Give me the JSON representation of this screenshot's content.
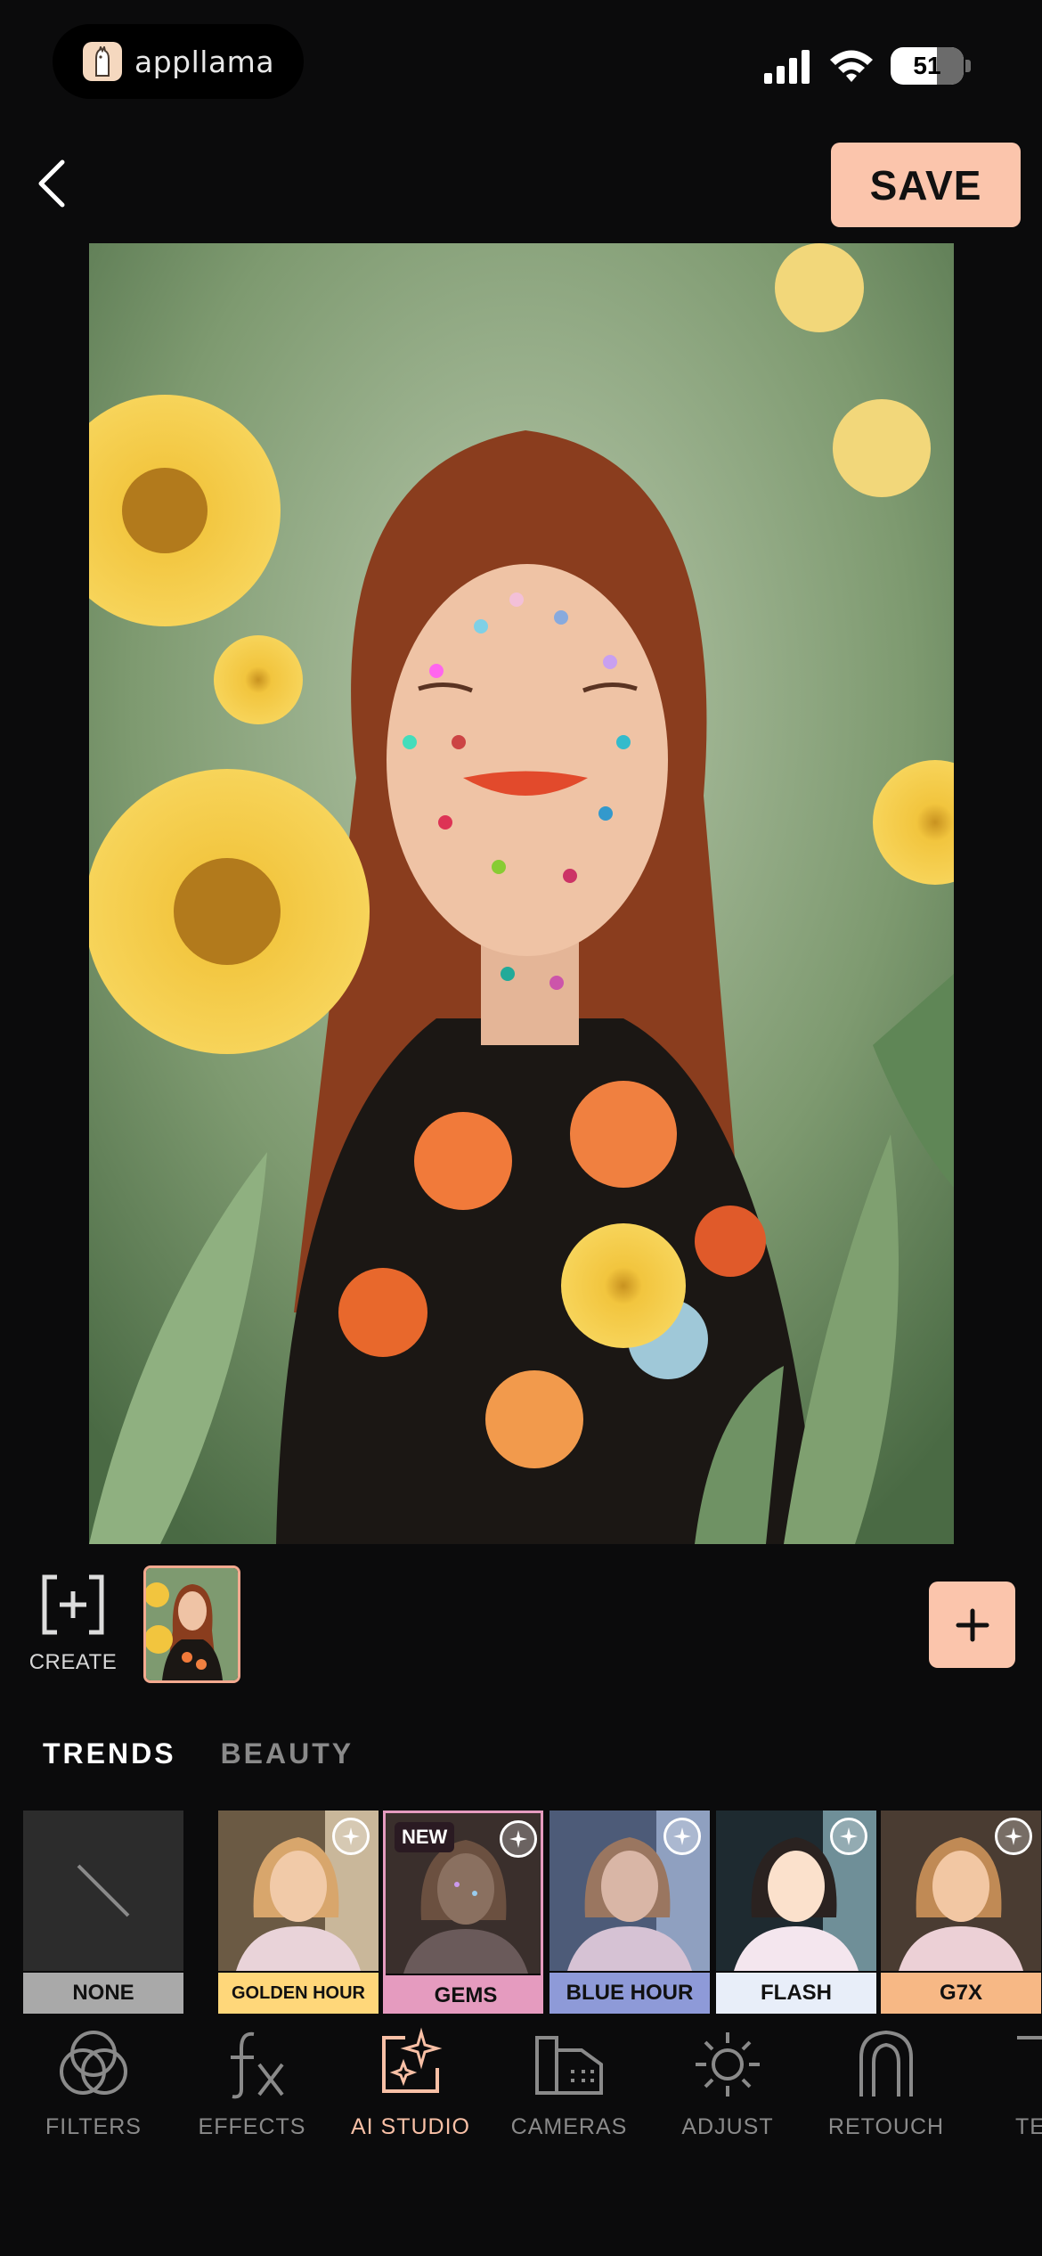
{
  "status_bar": {
    "app_pill_label": "appllama",
    "battery": "51"
  },
  "header": {
    "save_label": "SAVE"
  },
  "create": {
    "label": "CREATE"
  },
  "tabs": [
    {
      "label": "TRENDS",
      "active": true
    },
    {
      "label": "BEAUTY",
      "active": false
    }
  ],
  "presets": [
    {
      "label": "NONE",
      "label_color": "#a9a9a9"
    },
    {
      "label": "GOLDEN HOUR",
      "label_color": "#ffd77a"
    },
    {
      "label": "GEMS",
      "label_color": "#e59bbf",
      "badge": "NEW"
    },
    {
      "label": "BLUE HOUR",
      "label_color": "#8e9ad8"
    },
    {
      "label": "FLASH",
      "label_color": "#e8eef9"
    },
    {
      "label": "G7X",
      "label_color": "#f7b885"
    }
  ],
  "nav": [
    {
      "label": "FILTERS",
      "icon": "filters-icon"
    },
    {
      "label": "EFFECTS",
      "icon": "effects-icon"
    },
    {
      "label": "AI STUDIO",
      "icon": "ai-studio-icon",
      "active": true
    },
    {
      "label": "CAMERAS",
      "icon": "cameras-icon"
    },
    {
      "label": "ADJUST",
      "icon": "adjust-icon"
    },
    {
      "label": "RETOUCH",
      "icon": "retouch-icon"
    },
    {
      "label": "TE",
      "icon": "text-icon"
    }
  ],
  "colors": {
    "accent": "#fbc5ac",
    "active_nav": "#f9c0a6",
    "background": "#0b0b0c"
  }
}
